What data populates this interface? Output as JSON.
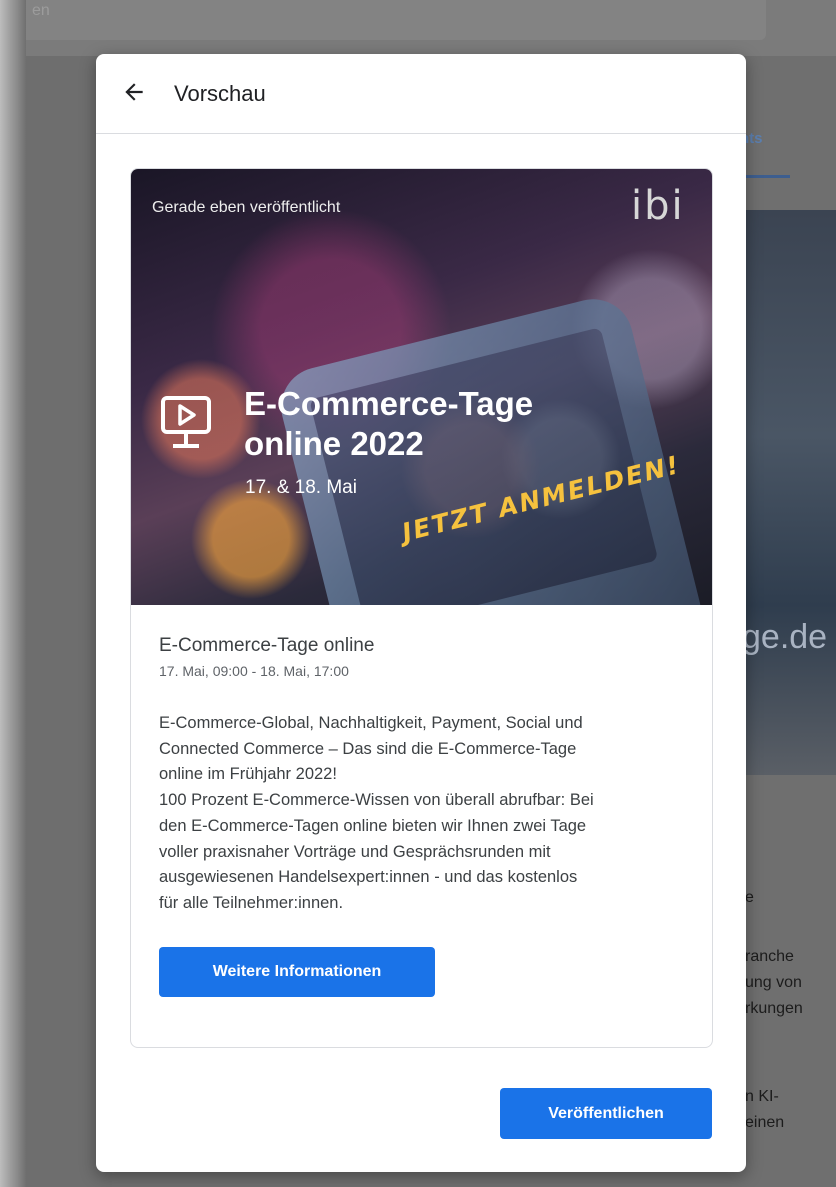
{
  "background": {
    "search_text": "en",
    "tab_label": "nts",
    "image_text": "ge.de",
    "text_lines": [
      "e",
      "ranche",
      "ung von",
      "rkungen",
      "n KI-",
      "einen"
    ]
  },
  "dialog": {
    "title": "Vorschau",
    "back_icon": "arrow-left-icon"
  },
  "banner": {
    "posted_label": "Gerade eben veröffentlicht",
    "logo_text": "ibi",
    "event_icon": "presentation-play-icon",
    "title_line1": "E-Commerce-Tage",
    "title_line2": "online 2022",
    "date": "17. & 18. Mai",
    "cta": "JETZT ANMELDEN!"
  },
  "event": {
    "name": "E-Commerce-Tage online",
    "time": "17. Mai, 09:00 - 18. Mai, 17:00",
    "description_lines": [
      "E-Commerce-Global, Nachhaltigkeit, Payment, Social und",
      "Connected Commerce – Das sind die E-Commerce-Tage",
      "online im Frühjahr 2022!",
      "100 Prozent E-Commerce-Wissen von überall abrufbar: Bei",
      "den E-Commerce-Tagen online bieten wir Ihnen zwei Tage",
      "voller praxisnaher Vorträge und Gesprächsrunden mit",
      "ausgewiesenen Handelsexpert:innen - und das kostenlos",
      "für alle Teilnehmer:innen."
    ],
    "more_button": "Weitere Informationen"
  },
  "actions": {
    "publish_button": "Veröffentlichen"
  },
  "colors": {
    "primary": "#1a73e8",
    "cta_yellow": "#f6c23e"
  }
}
